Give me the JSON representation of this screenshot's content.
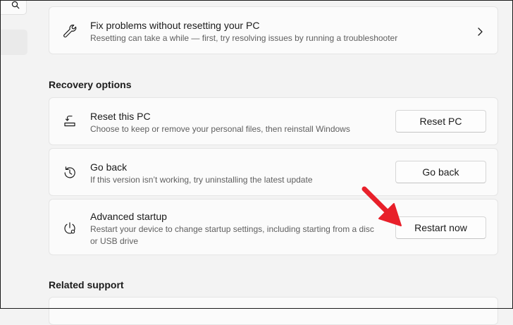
{
  "fix_problems": {
    "title": "Fix problems without resetting your PC",
    "description": "Resetting can take a while — first, try resolving issues by running a troubleshooter",
    "icon": "wrench-icon"
  },
  "recovery_options": {
    "heading": "Recovery options",
    "items": [
      {
        "title": "Reset this PC",
        "description": "Choose to keep or remove your personal files, then reinstall Windows",
        "button": "Reset PC",
        "icon": "reset-pc-icon"
      },
      {
        "title": "Go back",
        "description": "If this version isn’t working, try uninstalling the latest update",
        "button": "Go back",
        "icon": "history-icon"
      },
      {
        "title": "Advanced startup",
        "description": "Restart your device to change startup settings, including starting from a disc or USB drive",
        "button": "Restart now",
        "icon": "advanced-startup-icon"
      }
    ]
  },
  "related_support": {
    "heading": "Related support"
  },
  "colors": {
    "background": "#f3f3f3",
    "card": "#fbfbfb",
    "annotation_arrow": "#e8202a"
  }
}
